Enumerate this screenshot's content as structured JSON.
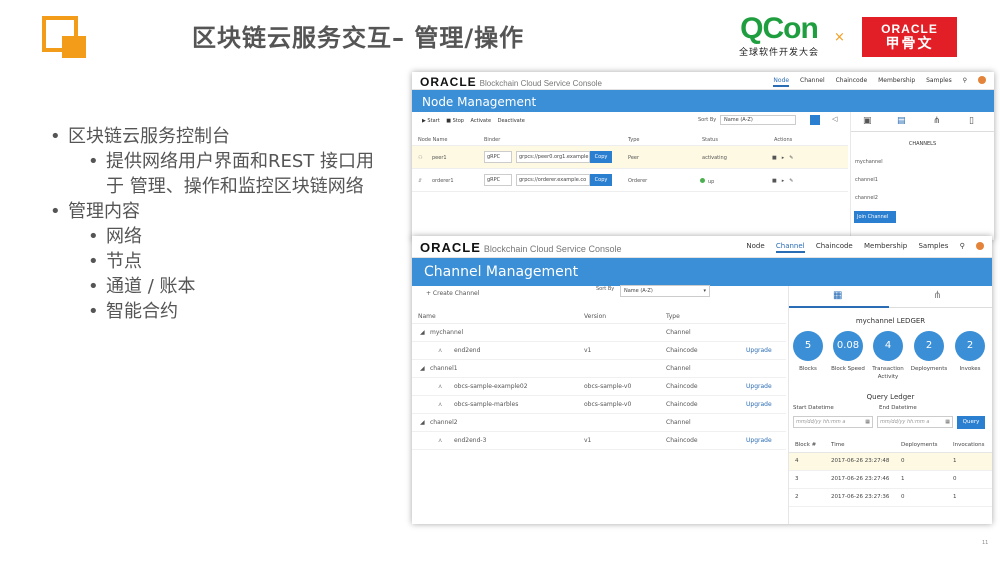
{
  "slide": {
    "title": "区块链云服务交互– 管理/操作",
    "page_number": "11"
  },
  "logos": {
    "qcon": "QCon",
    "qcon_sub": "全球软件开发大会",
    "times": "×",
    "oracle_line1": "ORACLE",
    "oracle_line2": "甲骨文"
  },
  "bullets": [
    {
      "level": 1,
      "text": "区块链云服务控制台"
    },
    {
      "level": 2,
      "text": "提供网络用户界面和REST 接口用于 管理、操作和监控区块链网络"
    },
    {
      "level": 1,
      "text": "管理内容"
    },
    {
      "level": 2,
      "text": "网络"
    },
    {
      "level": 2,
      "text": "节点"
    },
    {
      "level": 2,
      "text": "通道 / 账本"
    },
    {
      "level": 2,
      "text": "智能合约"
    }
  ],
  "node_console": {
    "brand": "ORACLE",
    "brand_sub": "Blockchain Cloud Service Console",
    "nav": [
      "Node",
      "Channel",
      "Chaincode",
      "Membership",
      "Samples"
    ],
    "active_nav": "Node",
    "page_title": "Node Management",
    "toolbar": {
      "start": "▶ Start",
      "stop": "■ Stop",
      "activate": "Activate",
      "deactivate": "Deactivate"
    },
    "sort_label": "Sort By",
    "sort_value": "Name (A-Z)",
    "columns": [
      "Node Name",
      "Binder",
      "Type",
      "Status",
      "Actions"
    ],
    "rows": [
      {
        "name": "peer1",
        "protocol": "gRPC",
        "address": "grpcs://peer0.org1.example",
        "copy": "Copy",
        "type": "Peer",
        "status": "activating"
      },
      {
        "name": "orderer1",
        "protocol": "gRPC",
        "address": "grpcs://orderer.example.co",
        "copy": "Copy",
        "type": "Orderer",
        "status": "up"
      }
    ],
    "side": {
      "title": "CHANNELS",
      "items": [
        "mychannel",
        "channel1",
        "channel2"
      ],
      "join_button": "Join Channel"
    }
  },
  "channel_console": {
    "brand": "ORACLE",
    "brand_sub": "Blockchain Cloud Service Console",
    "nav": [
      "Node",
      "Channel",
      "Chaincode",
      "Membership",
      "Samples"
    ],
    "active_nav": "Channel",
    "page_title": "Channel Management",
    "create_button": "+ Create Channel",
    "sort_label": "Sort By",
    "sort_value": "Name (A-Z)",
    "columns": [
      "Name",
      "Version",
      "Type"
    ],
    "rows": [
      {
        "name": "mychannel",
        "version": "",
        "type": "Channel",
        "action": "",
        "indent": false
      },
      {
        "name": "end2end",
        "version": "v1",
        "type": "Chaincode",
        "action": "Upgrade",
        "indent": true
      },
      {
        "name": "channel1",
        "version": "",
        "type": "Channel",
        "action": "",
        "indent": false
      },
      {
        "name": "obcs-sample-example02",
        "version": "obcs-sample-v0",
        "type": "Chaincode",
        "action": "Upgrade",
        "indent": true
      },
      {
        "name": "obcs-sample-marbles",
        "version": "obcs-sample-v0",
        "type": "Chaincode",
        "action": "Upgrade",
        "indent": true
      },
      {
        "name": "channel2",
        "version": "",
        "type": "Channel",
        "action": "",
        "indent": false
      },
      {
        "name": "end2end-3",
        "version": "v1",
        "type": "Chaincode",
        "action": "Upgrade",
        "indent": true
      }
    ],
    "ledger": {
      "title": "mychannel LEDGER",
      "stats": [
        {
          "value": "5",
          "label": "Blocks"
        },
        {
          "value": "0.08",
          "label": "Block Speed"
        },
        {
          "value": "4",
          "label": "Transaction Activity"
        },
        {
          "value": "2",
          "label": "Deployments"
        },
        {
          "value": "2",
          "label": "Invokes"
        }
      ],
      "query_title": "Query Ledger",
      "start_label": "Start Datetime",
      "end_label": "End Datetime",
      "start_placeholder": "mm/dd/yy hh:mm a",
      "end_placeholder": "mm/dd/yy hh:mm a",
      "query_button": "Query",
      "block_columns": [
        "Block #",
        "Time",
        "Deployments",
        "Invocations"
      ],
      "blocks": [
        {
          "block": "4",
          "time": "2017-06-26 23:27:48",
          "deployments": "0",
          "invocations": "1"
        },
        {
          "block": "3",
          "time": "2017-06-26 23:27:46",
          "deployments": "1",
          "invocations": "0"
        },
        {
          "block": "2",
          "time": "2017-06-26 23:27:36",
          "deployments": "0",
          "invocations": "1"
        }
      ]
    }
  }
}
